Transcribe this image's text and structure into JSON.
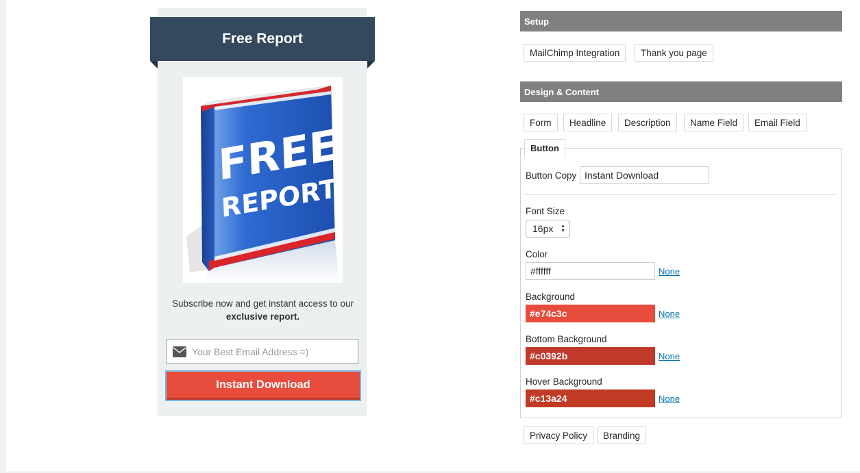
{
  "preview": {
    "title": "Free Report",
    "book_line1": "FREE",
    "book_line2": "REPORT",
    "description_line1": "Subscribe now and get instant access to our",
    "description_bold": "exclusive report.",
    "email_placeholder": "Your Best Email Address =)",
    "button_label": "Instant Download"
  },
  "setup": {
    "title": "Setup",
    "buttons": [
      "MailChimp Integration",
      "Thank you page"
    ]
  },
  "design": {
    "title": "Design & Content",
    "tabs": [
      "Form",
      "Headline",
      "Description",
      "Name Field",
      "Email Field"
    ],
    "active_tab": "Button"
  },
  "button_settings": {
    "copy_label": "Button Copy",
    "copy_value": "Instant Download",
    "font_size_label": "Font Size",
    "font_size_value": "16px",
    "color_label": "Color",
    "color_value": "#ffffff",
    "background_label": "Background",
    "background_value": "#e74c3c",
    "bottom_background_label": "Bottom Background",
    "bottom_background_value": "#c0392b",
    "hover_background_label": "Hover Background",
    "hover_background_value": "#c13a24",
    "none_label": "None"
  },
  "footer_buttons": [
    "Privacy Policy",
    "Branding"
  ],
  "colors": {
    "ribbon": "#34495e",
    "widget_bg": "#ecf0f1",
    "cta": "#e74c3c",
    "cta_bottom": "#c0392b",
    "section_bar": "#808080",
    "link": "#0073aa"
  },
  "icons": [
    "envelope-icon",
    "select-arrows-icon"
  ]
}
